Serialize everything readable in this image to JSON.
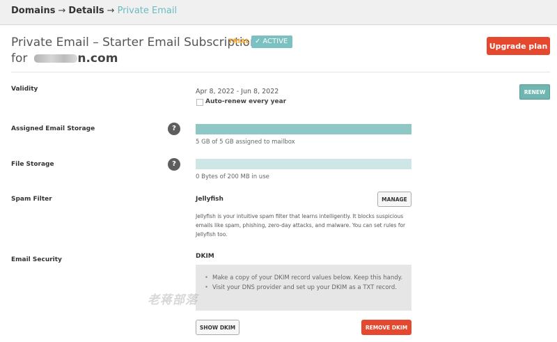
{
  "breadcrumb": {
    "items": [
      "Domains",
      "Details",
      "Private Email"
    ],
    "separator": "→"
  },
  "header": {
    "title": "Private Email – Starter Email Subscription",
    "trial_badge": "TRIAL",
    "status_badge": "ACTIVE",
    "domain_prefix": "for",
    "domain_suffix": "n.com",
    "upgrade_label": "Upgrade plan"
  },
  "colors": {
    "accent_teal": "#7bc1c1",
    "danger_red": "#e4482e",
    "trial_orange": "#f5a623"
  },
  "validity": {
    "label": "Validity",
    "dates": "Apr 8, 2022 - Jun 8, 2022",
    "auto_renew_label": "Auto-renew every year",
    "auto_renew_checked": false,
    "renew_label": "RENEW"
  },
  "email_storage": {
    "label": "Assigned Email Storage",
    "help_icon": "?",
    "usage_text": "5 GB of 5 GB assigned to mailbox",
    "fill_percent": 100
  },
  "file_storage": {
    "label": "File Storage",
    "help_icon": "?",
    "usage_text": "0 Bytes of 200 MB in use",
    "fill_percent": 0
  },
  "spam_filter": {
    "label": "Spam Filter",
    "name": "Jellyfish",
    "manage_label": "MANAGE",
    "description": "Jellyfish is your intuitive spam filter that learns intelligently. It blocks suspicious emails like spam, phishing, zero-day attacks, and malware. You can set rules for Jellyfish too."
  },
  "email_security": {
    "label": "Email Security",
    "dkim_title": "DKIM",
    "steps": [
      "Make a copy of your DKIM record values below. Keep this handy.",
      "Visit your DNS provider and set up your DKIM as a TXT record."
    ],
    "show_label": "SHOW DKIM",
    "remove_label": "REMOVE DKIM"
  },
  "watermark": "老蒋部落"
}
